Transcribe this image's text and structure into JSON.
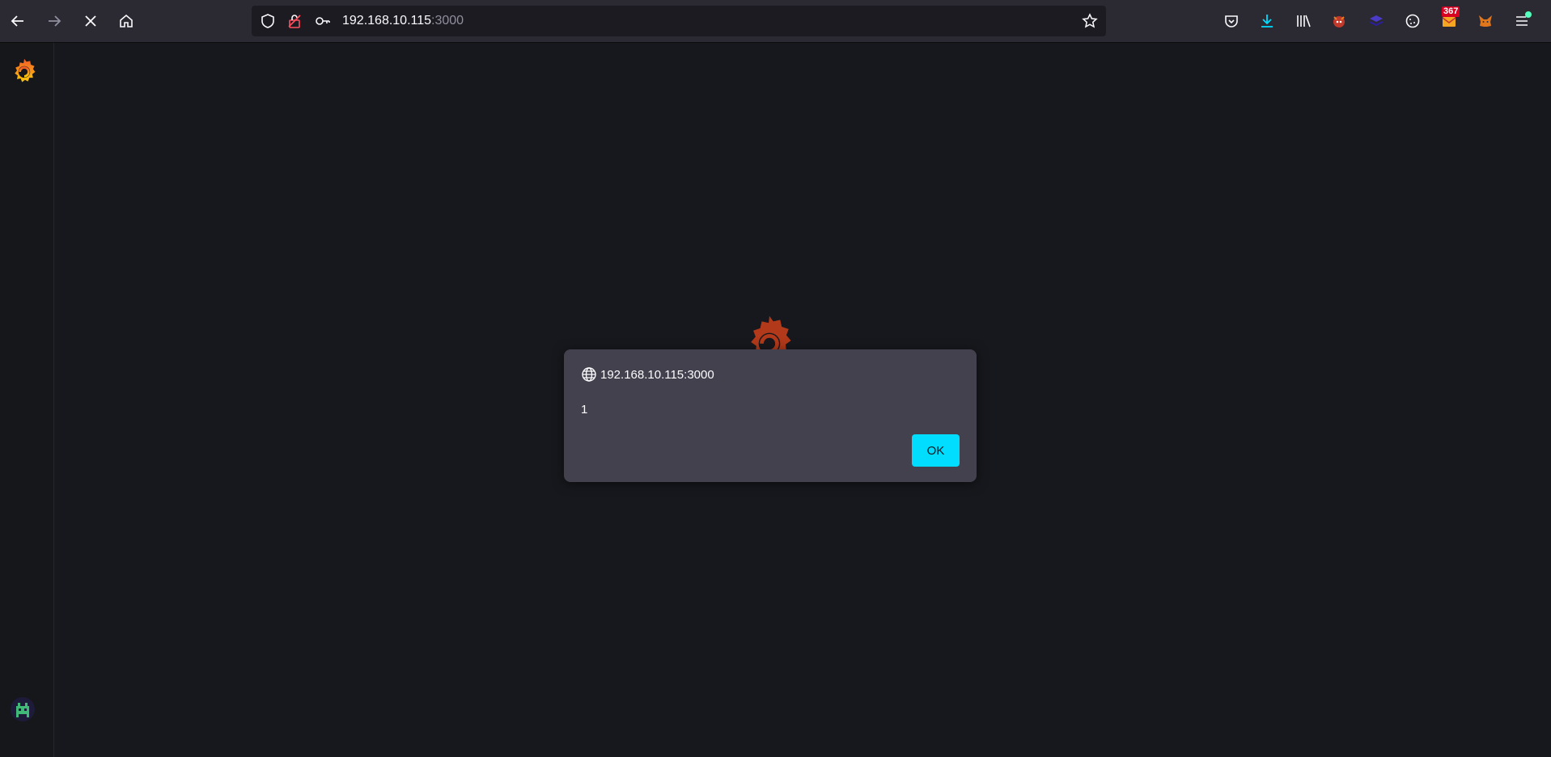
{
  "browser": {
    "url_host": "192.168.10.115",
    "url_port": ":3000",
    "badge_count": "367",
    "icons": [
      "back-arrow-icon",
      "forward-arrow-icon",
      "stop-icon",
      "home-icon",
      "shield-icon",
      "lock-icon",
      "key-icon",
      "star-icon",
      "pocket-icon",
      "download-icon",
      "library-icon",
      "extension-fox-icon",
      "extension-layers-icon",
      "cookie-icon",
      "mail-extension-icon",
      "metamask-fox-icon",
      "menu-icon"
    ]
  },
  "dialog": {
    "origin": "192.168.10.115:3000",
    "message": "1",
    "ok_label": "OK"
  },
  "colors": {
    "accent": "#00ddff",
    "grafana_orange": "#f05a28"
  }
}
